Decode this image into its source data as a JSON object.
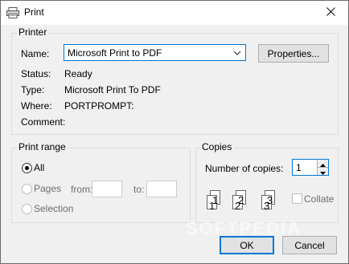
{
  "window": {
    "title": "Print"
  },
  "printer_group": {
    "legend": "Printer",
    "name_label": "Name:",
    "selected_printer": "Microsoft Print to PDF",
    "properties_button": "Properties...",
    "status_label": "Status:",
    "status_value": "Ready",
    "type_label": "Type:",
    "type_value": "Microsoft Print To PDF",
    "where_label": "Where:",
    "where_value": "PORTPROMPT:",
    "comment_label": "Comment:",
    "comment_value": ""
  },
  "print_range": {
    "legend": "Print range",
    "all_label": "All",
    "pages_label": "Pages",
    "from_label": "from:",
    "from_value": "",
    "to_label": "to:",
    "to_value": "",
    "selection_label": "Selection",
    "selected": "All"
  },
  "copies": {
    "legend": "Copies",
    "number_label": "Number of copies:",
    "number_value": "1",
    "collate_label": "Collate",
    "collate_checked": false
  },
  "buttons": {
    "ok": "OK",
    "cancel": "Cancel"
  },
  "watermark": "SOFTPEDIA",
  "icons": [
    "printer-icon",
    "close-icon",
    "dropdown-chevron-icon",
    "spin-up-icon",
    "spin-down-icon",
    "collate-pages-icon"
  ],
  "colors": {
    "accent": "#0078d7",
    "dialog_bg": "#f0f0f0",
    "button_bg": "#e1e1e1"
  }
}
